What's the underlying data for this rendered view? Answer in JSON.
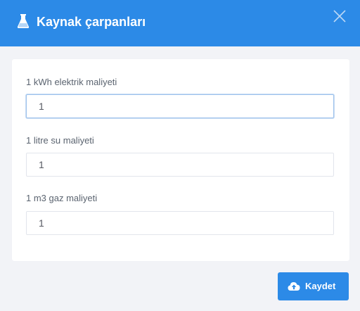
{
  "dialog": {
    "title": "Kaynak çarpanları",
    "title_icon": "flask-icon",
    "close_icon": "close-icon"
  },
  "form": {
    "fields": [
      {
        "label": "1 kWh elektrik maliyeti",
        "value": "1",
        "focused": true
      },
      {
        "label": "1 litre su maliyeti",
        "value": "1",
        "focused": false
      },
      {
        "label": "1 m3 gaz maliyeti",
        "value": "1",
        "focused": false
      }
    ]
  },
  "footer": {
    "save_label": "Kaydet",
    "save_icon": "cloud-upload-icon"
  },
  "colors": {
    "accent": "#2c8ae7",
    "background": "#f2f3f7",
    "panel": "#ffffff",
    "label_text": "#5b6470"
  }
}
